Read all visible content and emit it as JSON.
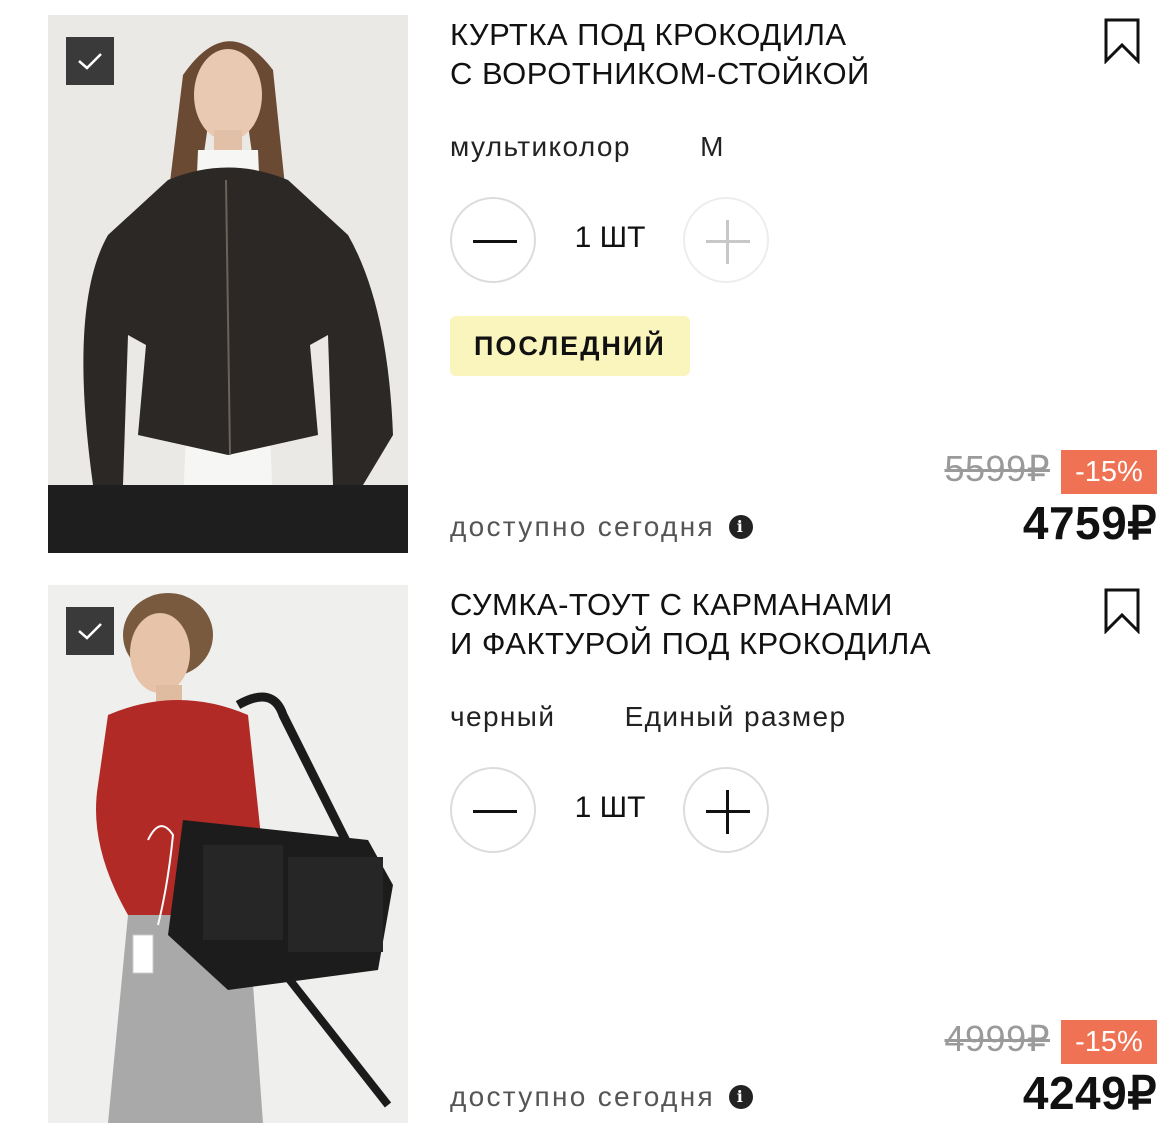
{
  "items": [
    {
      "title_line1": "КУРТКА ПОД КРОКОДИЛА",
      "title_line2": "С ВОРОТНИКОМ-СТОЙКОЙ",
      "color": "мультиколор",
      "size": "M",
      "quantity": "1 ШТ",
      "badge": "ПОСЛЕДНИЙ",
      "availability": "доступно сегодня",
      "old_price": "5599₽",
      "discount": "-15%",
      "price": "4759₽",
      "selected": true,
      "plus_enabled": false,
      "image": "woman-leather-jacket-photo"
    },
    {
      "title_line1": "СУМКА-ТОУТ С КАРМАНАМИ",
      "title_line2": "И ФАКТУРОЙ ПОД КРОКОДИЛА",
      "color": "черный",
      "size": "Единый размер",
      "quantity": "1 ШТ",
      "availability": "доступно сегодня",
      "old_price": "4999₽",
      "discount": "-15%",
      "price": "4249₽",
      "selected": true,
      "plus_enabled": true,
      "image": "woman-tote-bag-photo"
    }
  ],
  "colors": {
    "discount_bg": "#f07254",
    "badge_bg": "#faf4bd",
    "checkbox_bg": "#3a3a3a"
  }
}
